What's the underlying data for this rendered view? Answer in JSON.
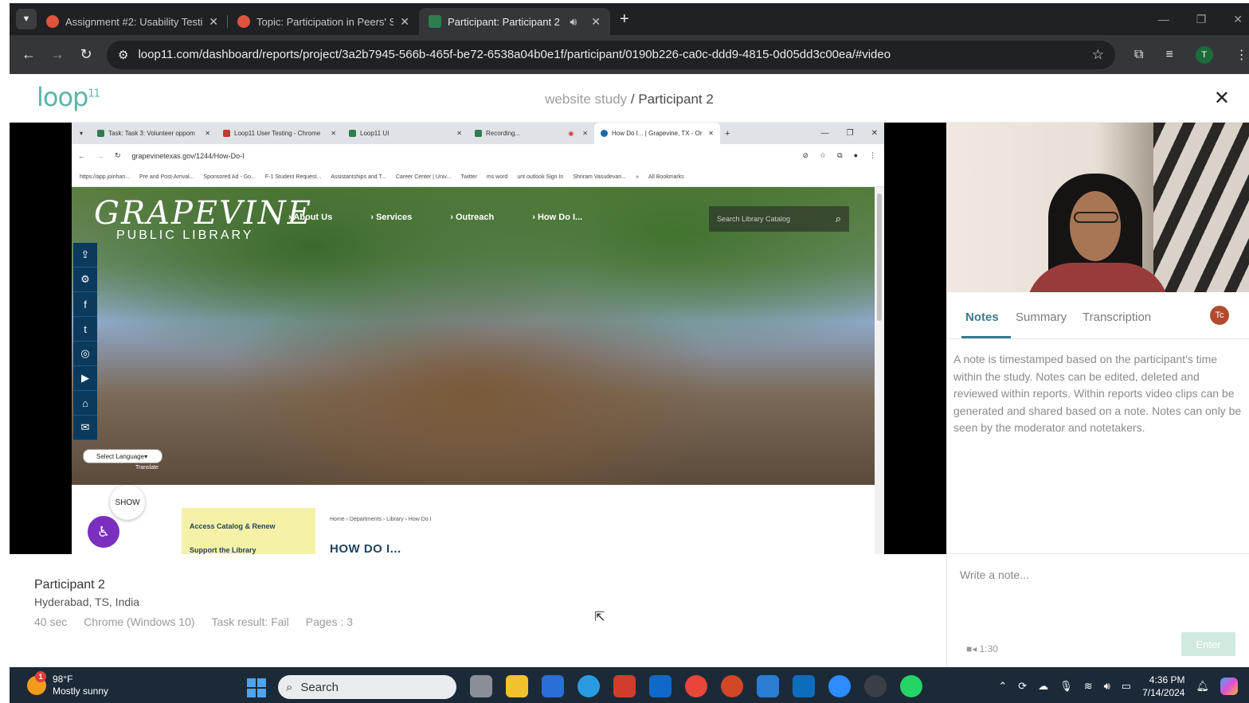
{
  "browser": {
    "tabs": [
      {
        "title": "Assignment #2: Usability Testin",
        "active": false
      },
      {
        "title": "Topic: Participation in Peers' Stu",
        "active": false
      },
      {
        "title": "Participant: Participant 2 - w",
        "active": true
      }
    ],
    "url": "loop11.com/dashboard/reports/project/3a2b7945-566b-465f-be72-6538a04b0e1f/participant/0190b226-ca0c-ddd9-4815-0d05dd3c00ea/#video",
    "profile_initial": "T"
  },
  "loop11": {
    "logo": "loop",
    "logo_sup": "11",
    "study_name": "website study",
    "separator": " / ",
    "participant_title": "Participant 2"
  },
  "recording": {
    "tabs": [
      {
        "title": "Task: Task 3: Volunteer oppom"
      },
      {
        "title": "Loop11 User Testing - Chrome"
      },
      {
        "title": "Loop11 UI"
      },
      {
        "title": "Recording..."
      },
      {
        "title": "How Do I... | Grapevine, TX - Or",
        "active": true
      }
    ],
    "url": "grapevinetexas.gov/1244/How-Do-I",
    "bookmarks": [
      "https://app.joinhan...",
      "Pre and Post-Arrival...",
      "Sponsored Ad - Go...",
      "F-1 Student Request...",
      "Assistantships and T...",
      "Career Center | Univ...",
      "Twitter",
      "ms word",
      "unt outlook Sign In",
      "Shriram Vasudevan...",
      "»",
      "All Bookmarks"
    ],
    "site": {
      "logo_main": "GRAPEVINE",
      "logo_sub": "PUBLIC LIBRARY",
      "nav": [
        "About Us",
        "Services",
        "Outreach",
        "How Do I..."
      ],
      "search_placeholder": "Search Library Catalog",
      "select_language": "Select Language",
      "translate_label": "Translate",
      "show_label": "SHOW",
      "sidebar_links": [
        "Access Catalog & Renew",
        "Support the Library"
      ],
      "breadcrumb": "Home › Departments › Library › How Do I",
      "heading": "HOW DO I..."
    }
  },
  "notes_panel": {
    "tabs": [
      "Notes",
      "Summary",
      "Transcription"
    ],
    "active_tab": "Notes",
    "user_initials": "Tc",
    "hint": "A note is timestamped based on the participant's time within the study. Notes can be edited, deleted and reviewed within reports. Within reports video clips can be generated and shared based on a note. Notes can only be seen by the moderator and notetakers.",
    "input_placeholder": "Write a note...",
    "timestamp": "1:30",
    "enter_label": "Enter"
  },
  "participant": {
    "name": "Participant 2",
    "location": "Hyderabad, TS, India",
    "duration": "40 sec",
    "browser_os": "Chrome (Windows 10)",
    "task_result": "Task result: Fail",
    "pages": "Pages : 3"
  },
  "taskbar": {
    "temperature": "98°F",
    "condition": "Mostly sunny",
    "weather_badge": "1",
    "search_label": "Search",
    "time": "4:36 PM",
    "date": "7/14/2024"
  }
}
